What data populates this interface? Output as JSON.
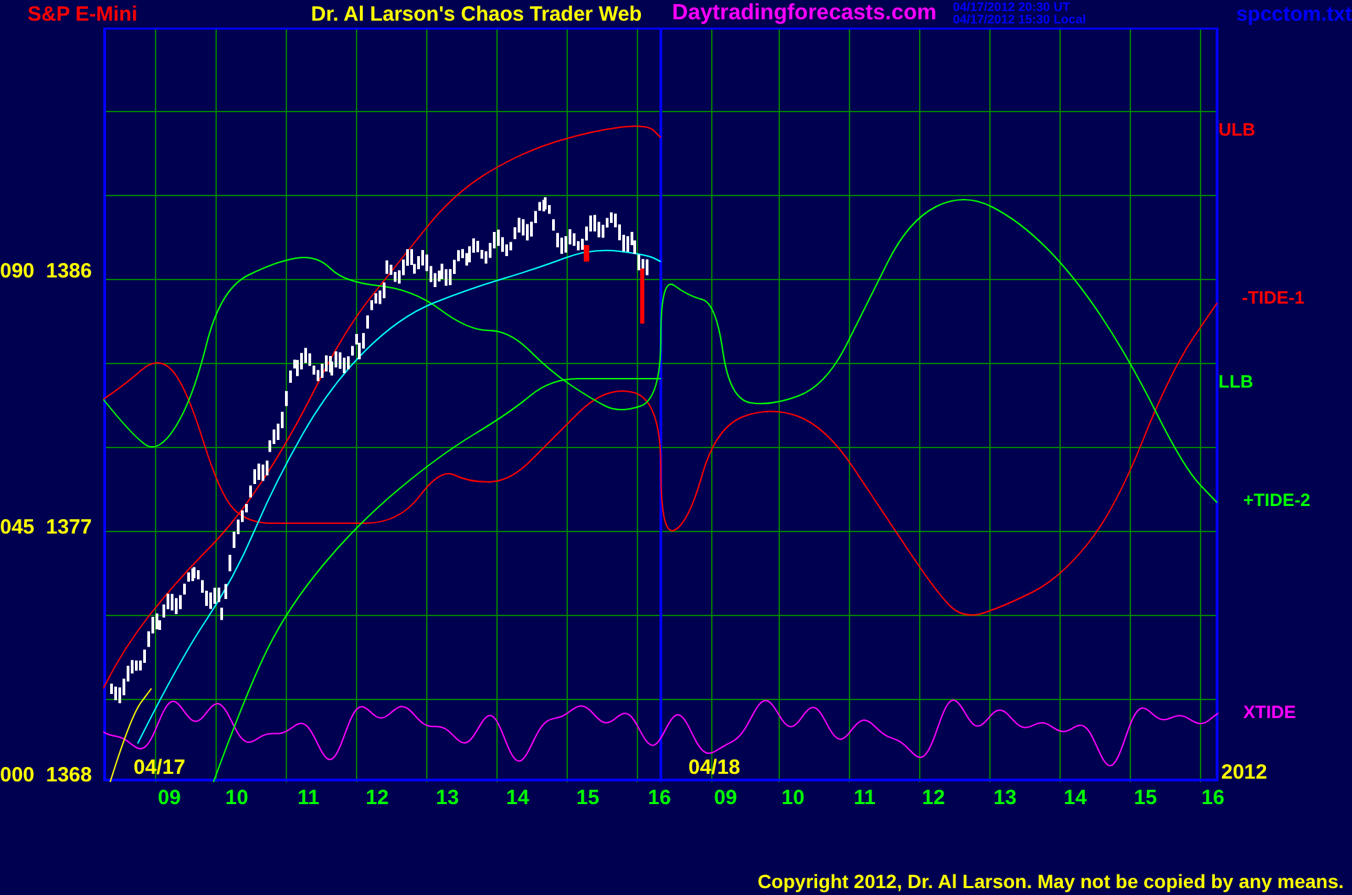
{
  "header": {
    "instrument": "S&P E-Mini",
    "title": "Dr. Al Larson's Chaos Trader Web",
    "site": "Daytradingforecasts.com",
    "timestamps": [
      "04/17/2012 20:30 UT",
      "04/17/2012 15:30 Local"
    ],
    "file": "spcctom.txt"
  },
  "y_axis": [
    {
      "code": "090",
      "price": "1386"
    },
    {
      "code": "045",
      "price": "1377"
    },
    {
      "code": "000",
      "price": "1368"
    }
  ],
  "series_labels": [
    {
      "label": "ULB",
      "color": "#ff0000"
    },
    {
      "label": "-TIDE-1",
      "color": "#ff0000"
    },
    {
      "label": "LLB",
      "color": "#00ff00"
    },
    {
      "label": "+TIDE-2",
      "color": "#00ff00"
    },
    {
      "label": "XTIDE",
      "color": "#ff00ff"
    }
  ],
  "date_labels": [
    "04/17",
    "04/18"
  ],
  "year": "2012",
  "hours": [
    "09",
    "10",
    "11",
    "12",
    "13",
    "14",
    "15",
    "16",
    "09",
    "10",
    "11",
    "12",
    "13",
    "14",
    "15",
    "16"
  ],
  "copyright": "Copyright 2012, Dr. Al Larson. May not be copied by any means."
}
